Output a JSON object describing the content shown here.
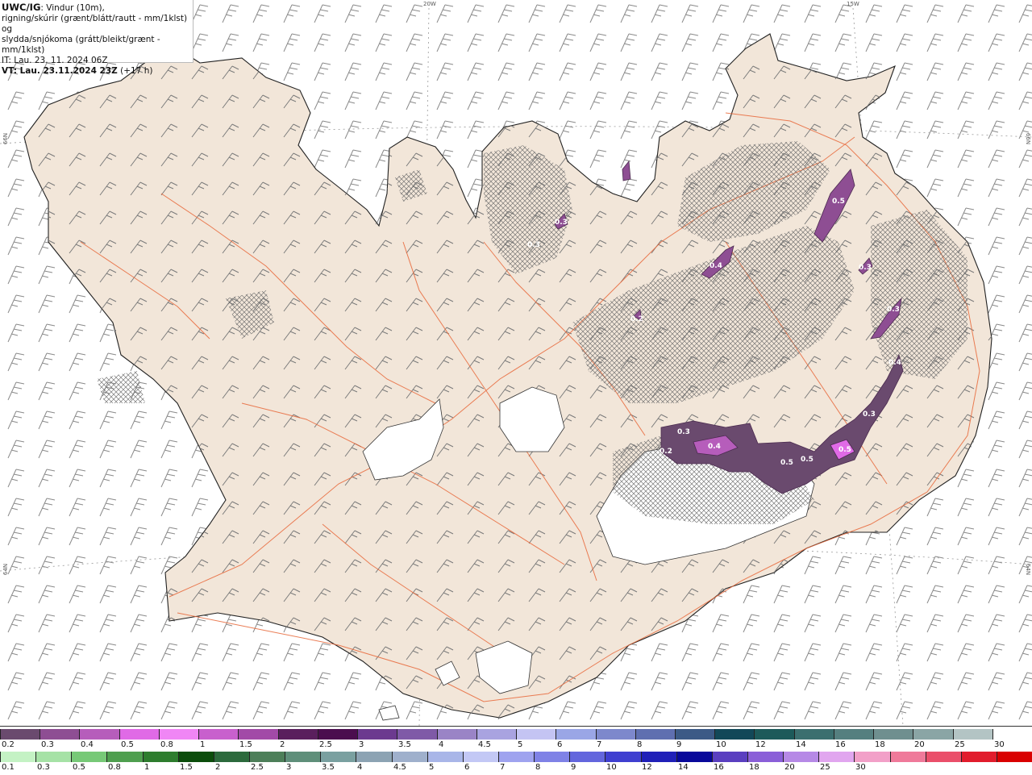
{
  "header": {
    "product": "UWC/IG",
    "line1_rest": ": Vindur (10m),",
    "line2": "rigning/skúrir (grænt/blátt/rautt - mm/1klst) og",
    "line3": "slydda/snjókoma (grátt/bleikt/grænt - mm/1klst)",
    "it_line": "IT: Lau. 23. 11. 2024 06Z",
    "vt_prefix": "VT: Lau. 23.11.2024 23Z",
    "vt_suffix": " (+17 h)"
  },
  "grid_labels": {
    "top_20w": "20W",
    "top_15w": "15W",
    "left_66n": "66N",
    "right_66n": "66N",
    "left_64n": "64N",
    "right_64n": "64N"
  },
  "precip_labels": [
    "0.3",
    "0.4",
    "0.5",
    "0.3",
    "0.3",
    "0.3",
    "0.4",
    "0.2",
    "0.3",
    "0.2",
    "0.4",
    "0.5",
    "0.5",
    "0.5",
    "0.3"
  ],
  "snow_legend": {
    "colors": [
      "#6a4a6e",
      "#8e4e93",
      "#b65dbb",
      "#e06ae6",
      "#f086f5",
      "#c860cd",
      "#a24aa7",
      "#5a1f5d",
      "#4b0d4e",
      "#6c3a8f",
      "#7f5aa7",
      "#9a84c6",
      "#a9a3e0",
      "#c4c4f3",
      "#9aa6e6",
      "#7d88cc",
      "#5f6fb0",
      "#3c5a86",
      "#124858",
      "#1d5a5a",
      "#3b6f6f",
      "#557f7f",
      "#6f8f8f",
      "#8aa5a5",
      "#b3c4c4",
      "#ffffff"
    ],
    "labels": [
      "0.2",
      "0.3",
      "0.4",
      "0.5",
      "0.8",
      "1",
      "1.5",
      "2",
      "2.5",
      "3",
      "3.5",
      "4",
      "4.5",
      "5",
      "6",
      "7",
      "8",
      "9",
      "10",
      "12",
      "14",
      "16",
      "18",
      "20",
      "25",
      "30"
    ]
  },
  "rain_legend": {
    "colors": [
      "#c4f2c4",
      "#a6e2a6",
      "#77c977",
      "#4f9f4f",
      "#2e7d2e",
      "#0b4d0b",
      "#2c6a3c",
      "#4d7f59",
      "#5f8f7a",
      "#7aa0a0",
      "#8ca3b3",
      "#9fb0cc",
      "#a9b6e8",
      "#c3c8f5",
      "#9fa3ef",
      "#7f82e6",
      "#6366dd",
      "#3f3fd0",
      "#2020b8",
      "#08089a",
      "#5a3fc0",
      "#8a5fd8",
      "#b689e6",
      "#e1a6ef",
      "#f2a0c8",
      "#ef7a9a",
      "#ea4f6a",
      "#e11c2c",
      "#d90000"
    ],
    "labels": [
      "0.1",
      "0.3",
      "0.5",
      "0.8",
      "1",
      "1.5",
      "2",
      "2.5",
      "3",
      "3.5",
      "4",
      "4.5",
      "5",
      "6",
      "7",
      "8",
      "9",
      "10",
      "12",
      "14",
      "16",
      "18",
      "20",
      "25",
      "30"
    ]
  },
  "colors": {
    "land": "#f2e6d9",
    "coast": "#222222",
    "roads": "#e8683a",
    "glacier": "#ffffff",
    "wind_barb": "#777777"
  }
}
